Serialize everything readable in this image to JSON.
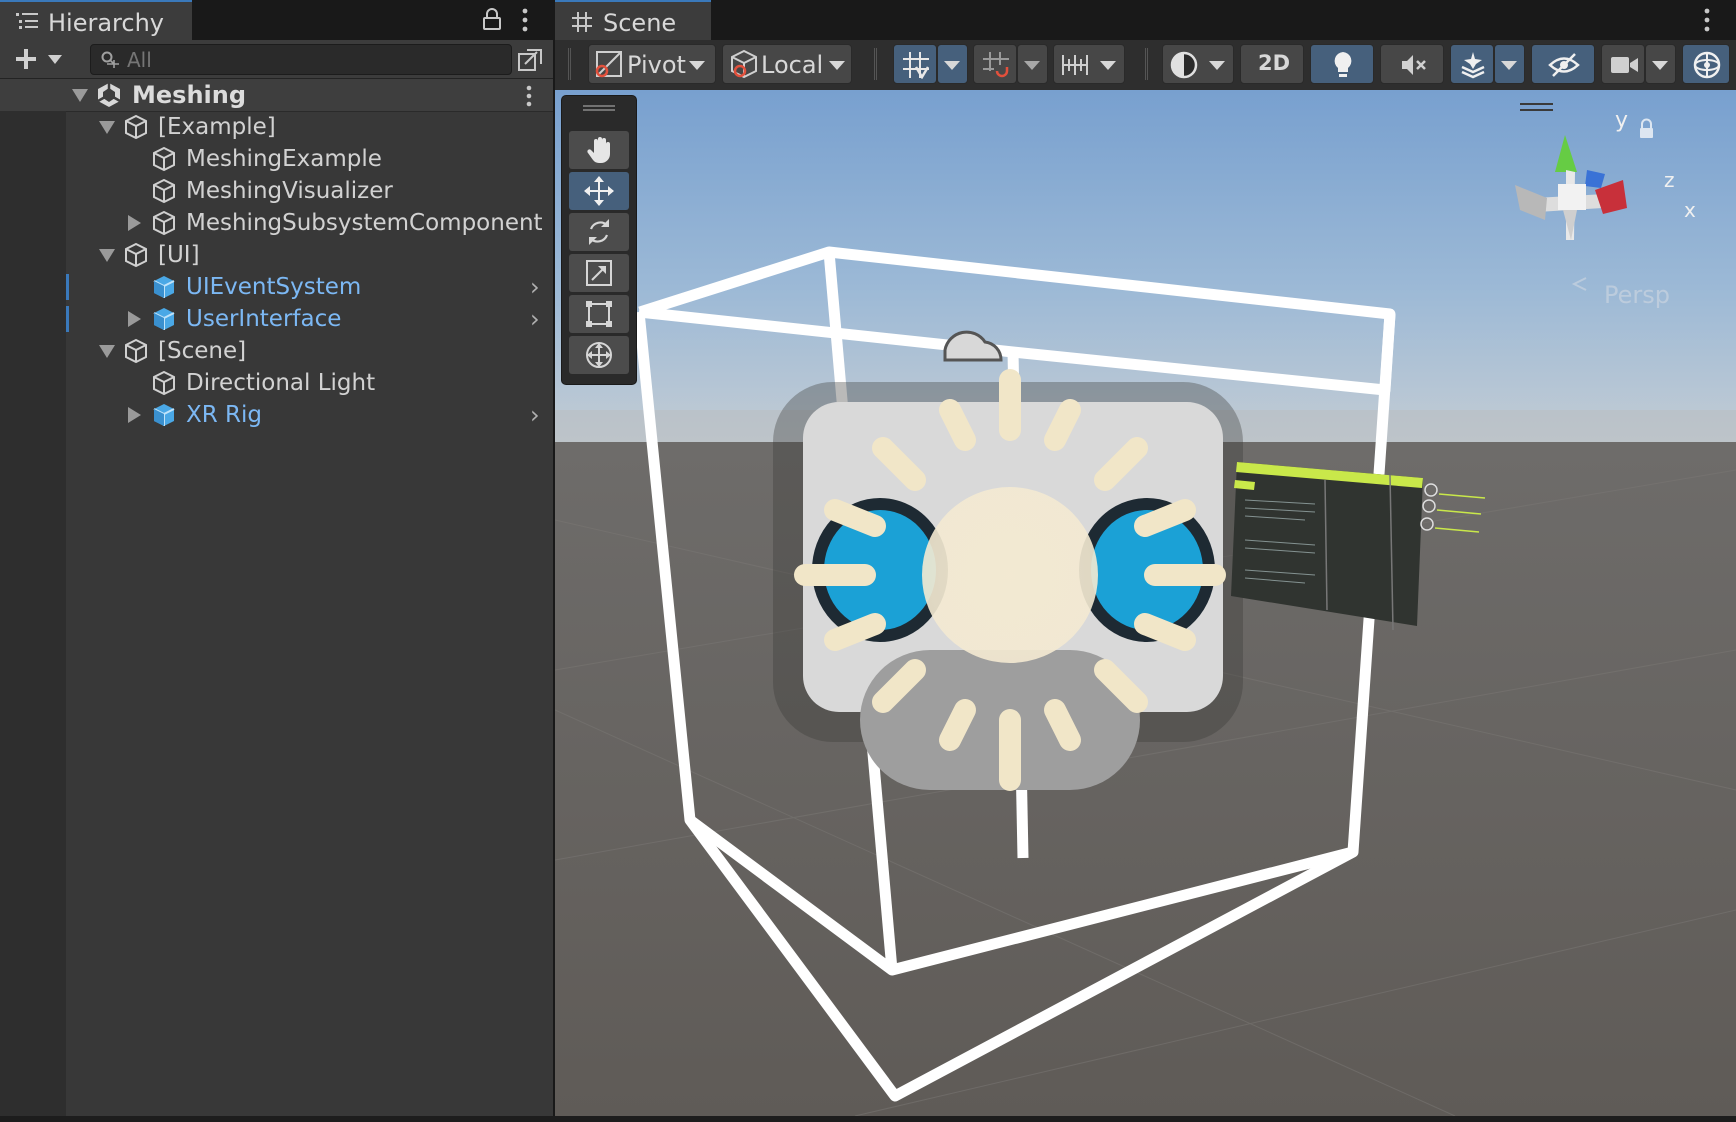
{
  "hierarchy": {
    "tab_label": "Hierarchy",
    "search_placeholder": "All",
    "scene_name": "Meshing",
    "items": [
      {
        "label": "[Example]",
        "kind": "gameobject",
        "expanded": true
      },
      {
        "label": "MeshingExample",
        "kind": "gameobject"
      },
      {
        "label": "MeshingVisualizer",
        "kind": "gameobject"
      },
      {
        "label": "MeshingSubsystemComponent",
        "kind": "gameobject",
        "collapsed": true
      },
      {
        "label": "[UI]",
        "kind": "gameobject",
        "expanded": true
      },
      {
        "label": "UIEventSystem",
        "kind": "prefab"
      },
      {
        "label": "UserInterface",
        "kind": "prefab",
        "collapsed": true
      },
      {
        "label": "[Scene]",
        "kind": "gameobject",
        "expanded": true
      },
      {
        "label": "Directional Light",
        "kind": "gameobject"
      },
      {
        "label": "XR Rig",
        "kind": "prefab",
        "collapsed": true
      }
    ]
  },
  "scene": {
    "tab_label": "Scene",
    "pivot_label": "Pivot",
    "local_label": "Local",
    "twod_label": "2D",
    "persp_label": "Persp",
    "axis_labels": {
      "y": "y",
      "z": "z",
      "x": "x"
    }
  },
  "colors": {
    "accent": "#3a79bb",
    "prefab_text": "#7cb8f4",
    "panel_bg": "#383838",
    "toolbar_active": "#46607c"
  },
  "icons": [
    "list-icon",
    "lock-icon",
    "kebab-icon",
    "plus-icon",
    "search-icon",
    "unity-logo-icon",
    "cube-icon",
    "prefab-cube-icon",
    "grid-icon",
    "hand-icon",
    "move-icon",
    "rotate-icon",
    "scale-icon",
    "rect-icon",
    "transform-icon",
    "light-bulb-icon",
    "audio-mute-icon",
    "effects-icon",
    "visibility-icon",
    "camera-icon",
    "gizmo-icon"
  ]
}
